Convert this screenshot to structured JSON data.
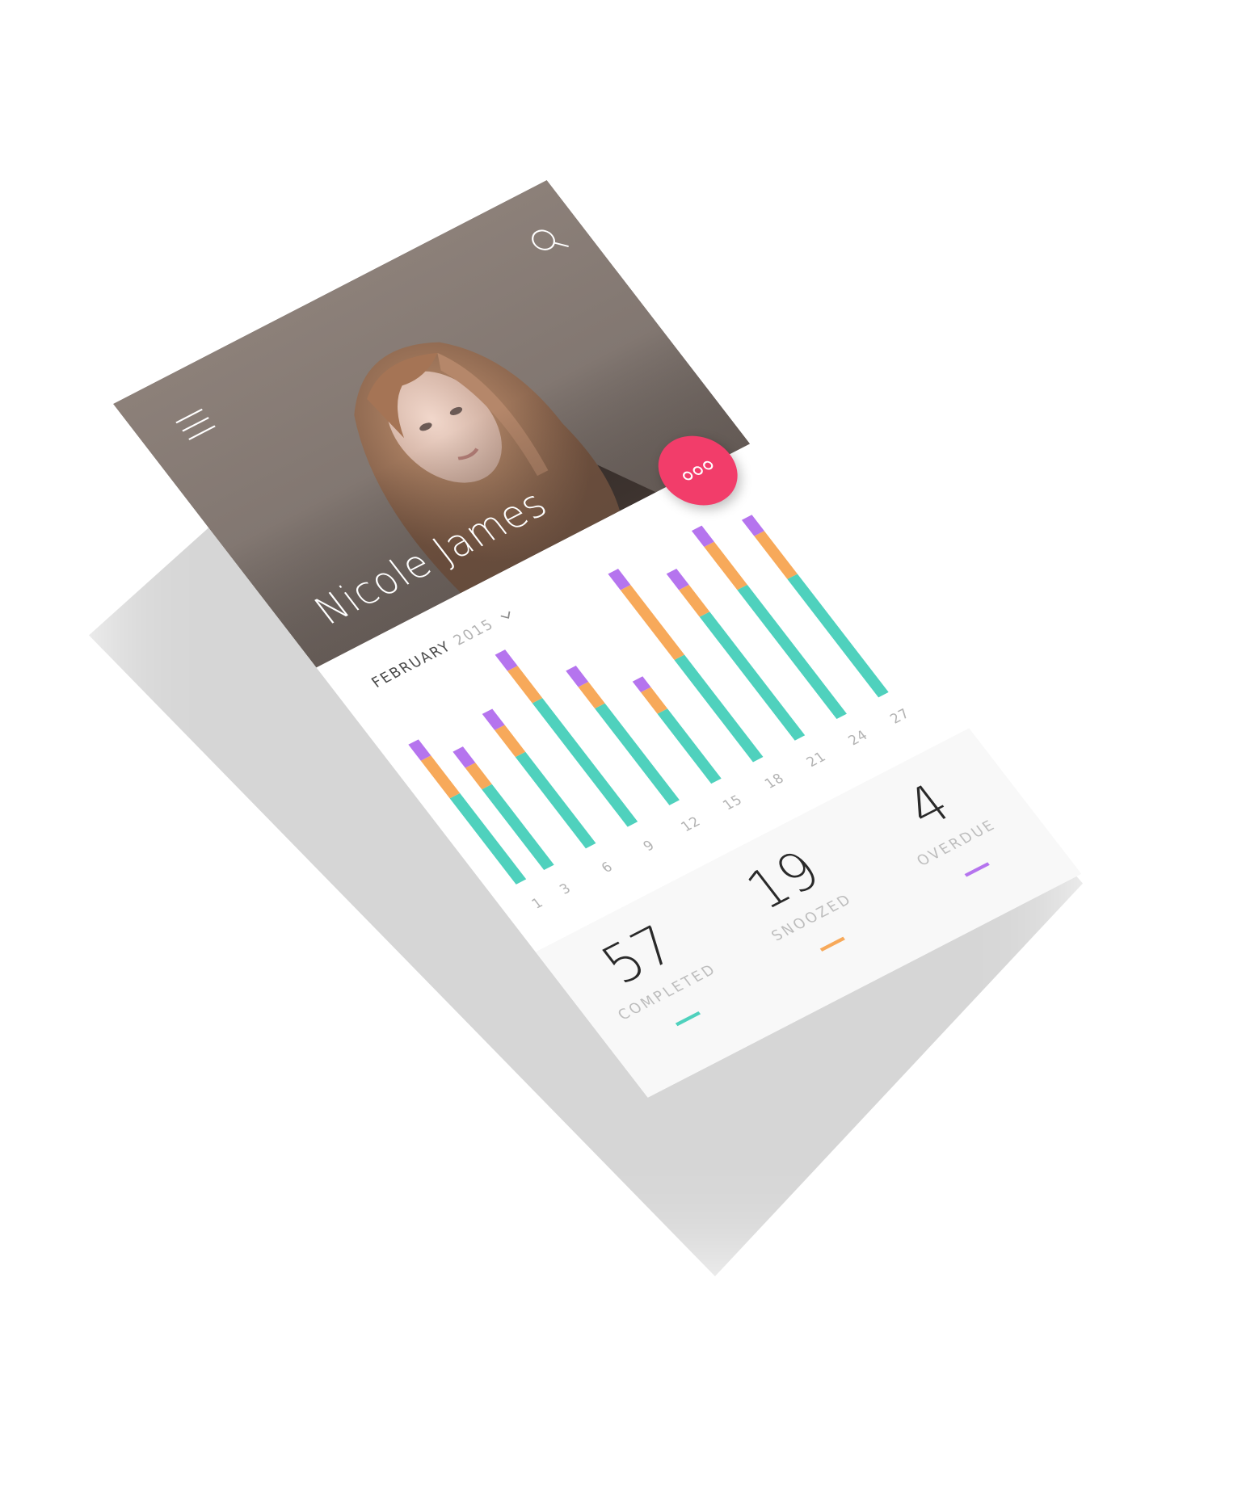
{
  "profile": {
    "name": "Nicole James"
  },
  "icons": {
    "menu": "hamburger-menu-icon",
    "search": "search-icon",
    "more": "more-dots-icon",
    "chevron": "chevron-down-icon"
  },
  "filter": {
    "month": "FEBRUARY",
    "year": "2015"
  },
  "colors": {
    "completed": "#4fd1bd",
    "snoozed": "#f7a95a",
    "overdue": "#b574ee",
    "fab": "#f23d6a",
    "tick": "#b3b3b3"
  },
  "chart_data": {
    "type": "bar",
    "stacked": true,
    "x": [
      1,
      3,
      6,
      9,
      12,
      15,
      18,
      21,
      24,
      27
    ],
    "categories": [
      "1",
      "3",
      "6",
      "9",
      "12",
      "15",
      "18",
      "21",
      "24",
      "27"
    ],
    "series": [
      {
        "name": "Completed",
        "color": "#4fd1bd",
        "values": [
          16,
          15,
          17,
          23,
          18,
          13,
          19,
          23,
          24,
          22
        ]
      },
      {
        "name": "Snoozed",
        "color": "#f7a95a",
        "values": [
          7,
          4,
          5,
          6,
          4,
          4,
          13,
          5,
          8,
          8
        ]
      },
      {
        "name": "Overdue",
        "color": "#b574ee",
        "values": [
          3,
          3,
          3,
          3,
          3,
          2,
          3,
          3,
          3,
          3
        ]
      }
    ],
    "ylim": [
      0,
      40
    ],
    "grid": false,
    "legend": "none"
  },
  "stats": {
    "completed": {
      "value": "57",
      "label": "COMPLETED"
    },
    "snoozed": {
      "value": "19",
      "label": "SNOOZED"
    },
    "overdue": {
      "value": "4",
      "label": "OVERDUE"
    }
  }
}
